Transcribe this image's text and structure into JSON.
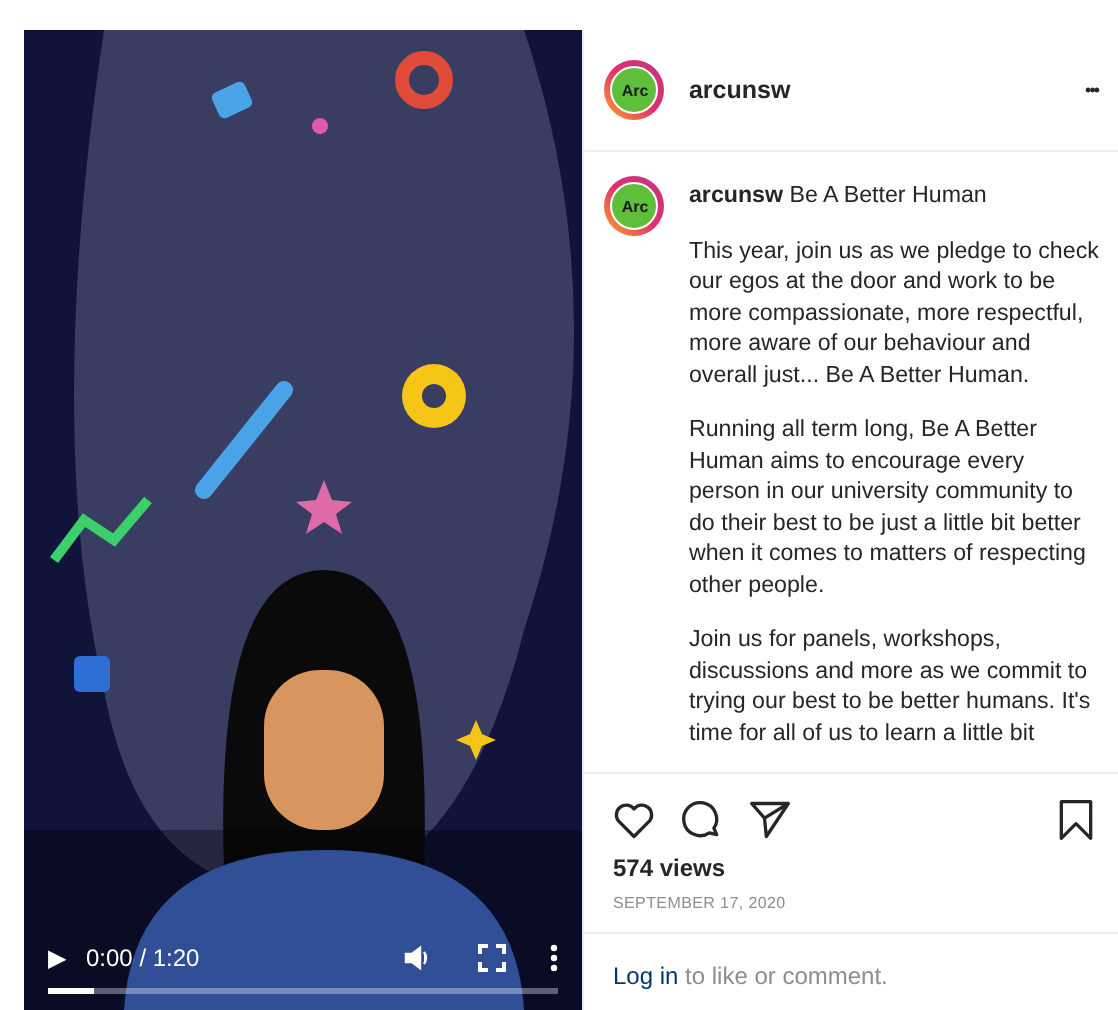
{
  "video": {
    "kind": "picture",
    "controls": {
      "play": "▶",
      "time": "0:00 / 1:20",
      "level": 0.09
    }
  },
  "post": {
    "header": {
      "avatar_text": "Arc",
      "username": "arcunsw",
      "more": "•••"
    },
    "caption": {
      "avatar_text": "Arc",
      "username": "arcunsw",
      "title": "Be A Better Human",
      "paragraphs": [
        "This year, join us as we pledge to check our egos at the door and work to be more compassionate, more respectful, more aware of our behaviour and overall just... Be A Better Human.",
        "Running all term long, Be A Better Human aims to encourage every person in our university community to do their best to be just a little bit better when it comes to matters of respecting other people.",
        "Join us for panels, workshops, discussions and more as we commit to trying our best to be better humans. It's time for all of us to learn a little bit"
      ]
    },
    "views": "574 views",
    "date": "SEPTEMBER 17, 2020",
    "login": {
      "link": "Log in",
      "rest": " to like or comment."
    }
  }
}
